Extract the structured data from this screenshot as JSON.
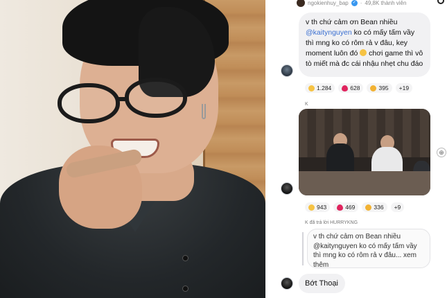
{
  "header": {
    "username": "ngokienhuy_bap",
    "verified_icon": "verified-check-icon",
    "followers": "49,8K thành viên"
  },
  "messages": [
    {
      "text_line1": "v th chứ cảm ơn Bean nhiều",
      "mention": "@kaitynguyen",
      "text_rest": " ko có mấy tấm vầy thì mng ko có rôm rả v đâu, key moment luôn đó ",
      "text_end": " chơi game thì vô tò miết mà đc cái nhậu nhẹt chu đáo",
      "reactions": [
        {
          "icon": "laugh-emoji-icon",
          "count": "1.284"
        },
        {
          "icon": "heart-icon",
          "count": "628"
        },
        {
          "icon": "grin-emoji-icon",
          "count": "395"
        }
      ],
      "more_reactions": "+19"
    },
    {
      "sender": "K",
      "reactions": [
        {
          "icon": "laugh-emoji-icon",
          "count": "943"
        },
        {
          "icon": "heart-icon",
          "count": "469"
        },
        {
          "icon": "grin-emoji-icon",
          "count": "336"
        }
      ],
      "more_reactions": "+9"
    },
    {
      "reply_header": "K đã trả lời HURRYKNG",
      "quoted": "v th chứ cảm ơn Bean nhiều @kaitynguyen ko có mấy tấm vầy thì mng ko có rôm rả v đâu... xem thêm",
      "text": "Bớt Thoại"
    }
  ]
}
